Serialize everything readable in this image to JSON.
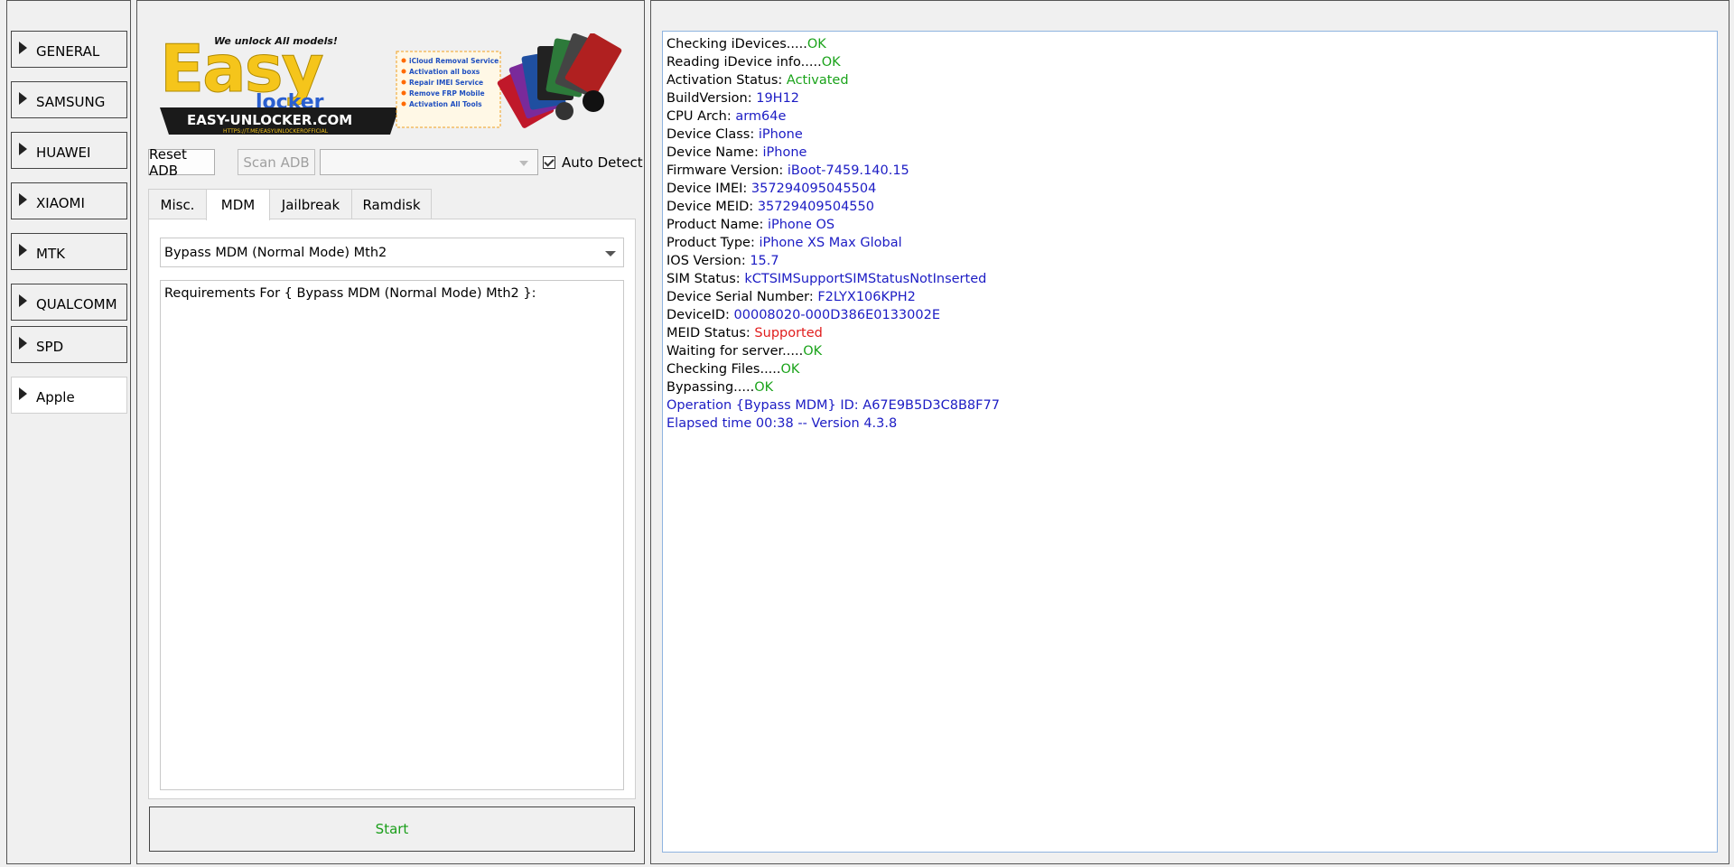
{
  "sidebar": {
    "items": [
      {
        "label": "GENERAL",
        "active": false
      },
      {
        "label": "SAMSUNG",
        "active": false
      },
      {
        "label": "HUAWEI",
        "active": false
      },
      {
        "label": "XIAOMI",
        "active": false
      },
      {
        "label": "MTK",
        "active": false
      },
      {
        "label": "QUALCOMM",
        "active": false
      },
      {
        "label": "SPD",
        "active": false
      },
      {
        "label": "Apple",
        "active": true
      }
    ]
  },
  "banner": {
    "tagline": "We unlock All models!",
    "logo_big": "Easy",
    "logo_small": "locker",
    "site": "EASY-UNLOCKER.COM",
    "url": "HTTPS://T.ME/EASYUNLOCKEROFFICIAL",
    "services": [
      "iCloud Removal Service",
      "Activation all boxs",
      "Repair IMEI Service",
      "Remove FRP Mobile",
      "Activation All Tools"
    ]
  },
  "toolbar": {
    "reset_adb": "Reset ADB",
    "scan_adb": "Scan ADB",
    "combo_value": "",
    "auto_detect": "Auto Detect"
  },
  "tabs": [
    {
      "label": "Misc.",
      "active": false
    },
    {
      "label": "MDM",
      "active": true
    },
    {
      "label": "Jailbreak",
      "active": false
    },
    {
      "label": "Ramdisk",
      "active": false
    }
  ],
  "mdm": {
    "selected_method": "Bypass MDM (Normal Mode) Mth2",
    "requirements_text": "Requirements For { Bypass MDM (Normal Mode) Mth2 }:"
  },
  "start_label": "Start",
  "colors": {
    "ok": "#1aa31a",
    "value": "#1c1cc4",
    "error": "#e01c1c",
    "start_text": "#1a9e1a"
  },
  "log": [
    {
      "label": "Checking iDevices.....",
      "value": "OK",
      "color": "green"
    },
    {
      "label": "Reading iDevice info.....",
      "value": "OK",
      "color": "green"
    },
    {
      "label": "Activation Status: ",
      "value": "Activated",
      "color": "green"
    },
    {
      "label": "BuildVersion: ",
      "value": "19H12",
      "color": "blue"
    },
    {
      "label": "CPU Arch: ",
      "value": "arm64e",
      "color": "blue"
    },
    {
      "label": "Device Class: ",
      "value": "iPhone",
      "color": "blue"
    },
    {
      "label": "Device Name: ",
      "value": "iPhone",
      "color": "blue"
    },
    {
      "label": "Firmware Version: ",
      "value": "iBoot-7459.140.15",
      "color": "blue"
    },
    {
      "label": "Device IMEI: ",
      "value": "357294095045504",
      "color": "blue"
    },
    {
      "label": "Device MEID: ",
      "value": "35729409504550",
      "color": "blue"
    },
    {
      "label": "Product Name: ",
      "value": "iPhone OS",
      "color": "blue"
    },
    {
      "label": "Product Type: ",
      "value": "iPhone XS Max Global",
      "color": "blue"
    },
    {
      "label": "IOS Version: ",
      "value": "15.7",
      "color": "blue"
    },
    {
      "label": "SIM Status: ",
      "value": "kCTSIMSupportSIMStatusNotInserted",
      "color": "blue"
    },
    {
      "label": "Device Serial Number: ",
      "value": "F2LYX106KPH2",
      "color": "blue"
    },
    {
      "label": "DeviceID: ",
      "value": "00008020-000D386E0133002E",
      "color": "blue"
    },
    {
      "label": "MEID Status: ",
      "value": "Supported",
      "color": "red"
    },
    {
      "label": "Waiting for server.....",
      "value": "OK",
      "color": "green"
    },
    {
      "label": "Checking Files.....",
      "value": "OK",
      "color": "green"
    },
    {
      "label": "Bypassing.....",
      "value": "OK",
      "color": "green"
    },
    {
      "label": "",
      "value": "Operation {Bypass MDM} ID: A67E9B5D3C8B8F77",
      "color": "blue"
    },
    {
      "label": "",
      "value": "Elapsed time 00:38 -- Version 4.3.8",
      "color": "blue"
    }
  ]
}
